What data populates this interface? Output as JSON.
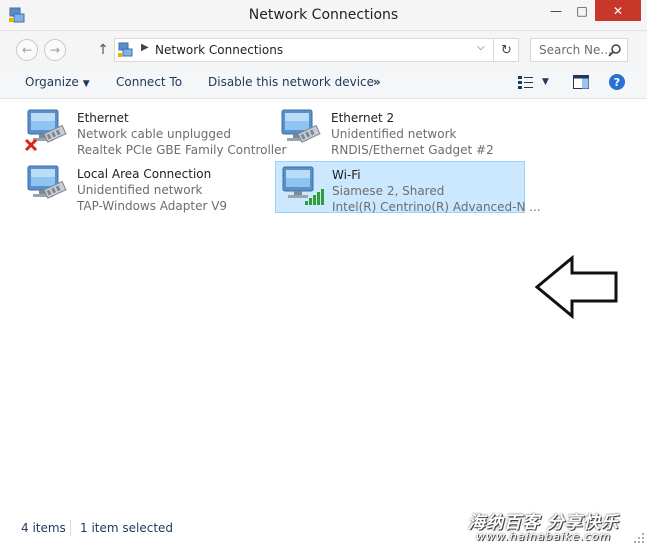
{
  "window": {
    "title": "Network Connections",
    "controls": {
      "minimize": "—",
      "maximize": "□",
      "close": "✕"
    }
  },
  "address": {
    "breadcrumb": "Network Connections",
    "search_placeholder": "Search Ne..."
  },
  "commands": {
    "organize": "Organize",
    "connect_to": "Connect To",
    "disable": "Disable this network device",
    "more": "»"
  },
  "connections": [
    {
      "name": "Ethernet",
      "status": "Network cable unplugged",
      "adapter": "Realtek PCIe GBE Family Controller",
      "state": "disconnected",
      "selected": false
    },
    {
      "name": "Ethernet 2",
      "status": "Unidentified network",
      "adapter": "RNDIS/Ethernet Gadget #2",
      "state": "connected",
      "selected": false
    },
    {
      "name": "Local Area Connection",
      "status": "Unidentified network",
      "adapter": "TAP-Windows Adapter V9",
      "state": "connected",
      "selected": false
    },
    {
      "name": "Wi-Fi",
      "status": "Siamese  2, Shared",
      "adapter": "Intel(R) Centrino(R) Advanced-N ...",
      "state": "wireless",
      "selected": true
    }
  ],
  "status": {
    "item_count": "4 items",
    "selection": "1 item selected"
  },
  "watermark": {
    "text": "海纳百客 分享快乐",
    "url": "www.hainabaike.com"
  },
  "colors": {
    "selection_fill": "#cce8ff",
    "selection_border": "#99d1ff",
    "close_button": "#c7382a",
    "command_text": "#1e395b"
  },
  "icons": [
    "network-icon",
    "back-icon",
    "forward-icon",
    "up-icon",
    "refresh-icon",
    "search-icon",
    "views-icon",
    "preview-pane-icon",
    "help-icon",
    "network-adapter-icon",
    "disconnected-x-icon",
    "wifi-signal-icon",
    "pointer-arrow-icon"
  ]
}
